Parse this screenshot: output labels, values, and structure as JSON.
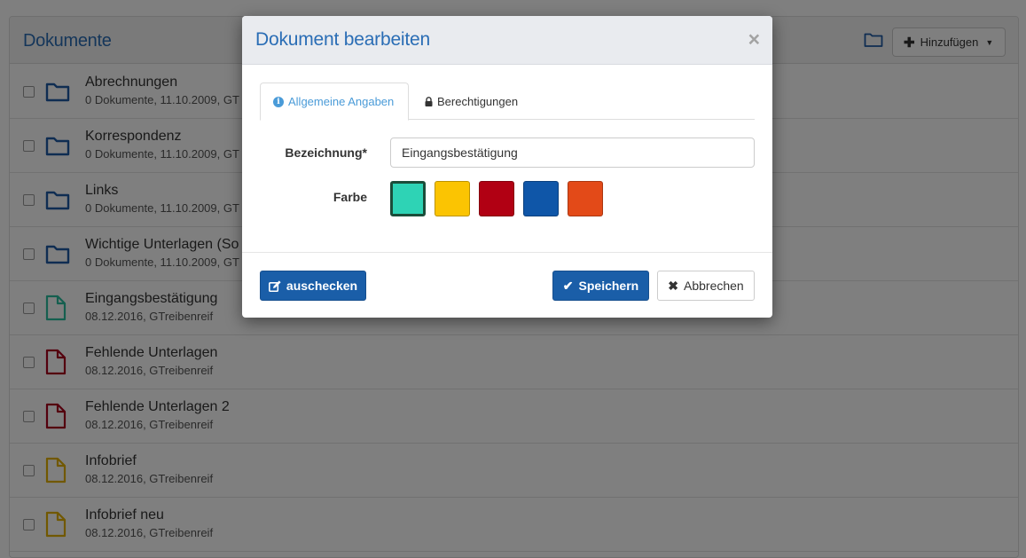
{
  "panel": {
    "title": "Dokumente",
    "add_button_label": "Hinzufügen"
  },
  "rows": [
    {
      "type": "folder",
      "name": "Abrechnungen",
      "meta": "0 Dokumente, 11.10.2009, GT",
      "color": "#1f5aa5"
    },
    {
      "type": "folder",
      "name": "Korrespondenz",
      "meta": "0 Dokumente, 11.10.2009, GT",
      "color": "#1f5aa5"
    },
    {
      "type": "folder",
      "name": "Links",
      "meta": "0 Dokumente, 11.10.2009, GT",
      "color": "#1f5aa5"
    },
    {
      "type": "folder",
      "name": "Wichtige Unterlagen (So",
      "meta": "0 Dokumente, 11.10.2009, GT",
      "color": "#1f5aa5"
    },
    {
      "type": "file",
      "name": "Eingangsbestätigung",
      "meta": "08.12.2016, GTreibenreif",
      "color": "#2bbf9e"
    },
    {
      "type": "file",
      "name": "Fehlende Unterlagen",
      "meta": "08.12.2016, GTreibenreif",
      "color": "#a8001c"
    },
    {
      "type": "file",
      "name": "Fehlende Unterlagen 2",
      "meta": "08.12.2016, GTreibenreif",
      "color": "#a8001c"
    },
    {
      "type": "file",
      "name": "Infobrief",
      "meta": "08.12.2016, GTreibenreif",
      "color": "#e2b000"
    },
    {
      "type": "file",
      "name": "Infobrief neu",
      "meta": "08.12.2016, GTreibenreif",
      "color": "#e2b000"
    }
  ],
  "modal": {
    "title": "Dokument bearbeiten",
    "close_label": "×",
    "tabs": [
      {
        "label": "Allgemeine Angaben",
        "icon": "info-icon",
        "active": true
      },
      {
        "label": "Berechtigungen",
        "icon": "lock-icon",
        "active": false
      }
    ],
    "fields": {
      "name_label": "Bezeichnung*",
      "name_value": "Eingangsbestätigung",
      "color_label": "Farbe"
    },
    "colors": [
      {
        "name": "teal",
        "hex": "#2ed3b5",
        "selected": true
      },
      {
        "name": "yellow",
        "hex": "#fbc402",
        "selected": false
      },
      {
        "name": "red",
        "hex": "#b10013",
        "selected": false
      },
      {
        "name": "blue",
        "hex": "#0f56a8",
        "selected": false
      },
      {
        "name": "orange",
        "hex": "#e34a18",
        "selected": false
      }
    ],
    "buttons": {
      "checkout": "auschecken",
      "save": "Speichern",
      "cancel": "Abbrechen"
    }
  }
}
